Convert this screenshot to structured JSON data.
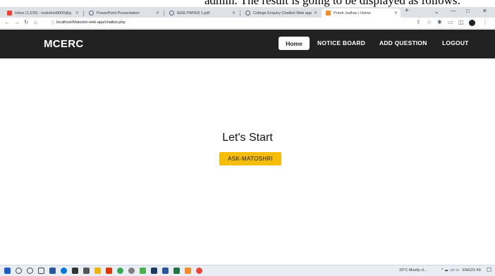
{
  "caption": "admin. The result is going to be displayed as follows:",
  "browser": {
    "tabs": [
      {
        "label": "Inbox (1,529) - mokshini0000@g",
        "color": "#ea4335"
      },
      {
        "label": "PowerPoint Presentation",
        "color": "#5f6368"
      },
      {
        "label": "IEEE PAPER 1.pdf",
        "color": "#5f6368"
      },
      {
        "label": "College Enquiry Chatbot Web app",
        "color": "#5f6368"
      },
      {
        "label": "Preeti Jadhav | Home",
        "color": "#f28b2c"
      }
    ],
    "url": "localhost/Matoshri-web-app/chatbot.php",
    "new_tab": "+",
    "win": {
      "minimize": "—",
      "maximize": "□",
      "close": "✕",
      "chevron": "⌄"
    }
  },
  "site": {
    "brand": "MCERC",
    "nav": {
      "home": "Home",
      "notice": "NOTICE BOARD",
      "add_question": "ADD QUESTION",
      "logout": "LOGOUT"
    }
  },
  "hero": {
    "title": "Let's Start",
    "button": "ASK-MATOSHRI"
  },
  "taskbar": {
    "weather": "33°C  Mostly cl...",
    "lang": "ENG",
    "time": "21:49"
  }
}
